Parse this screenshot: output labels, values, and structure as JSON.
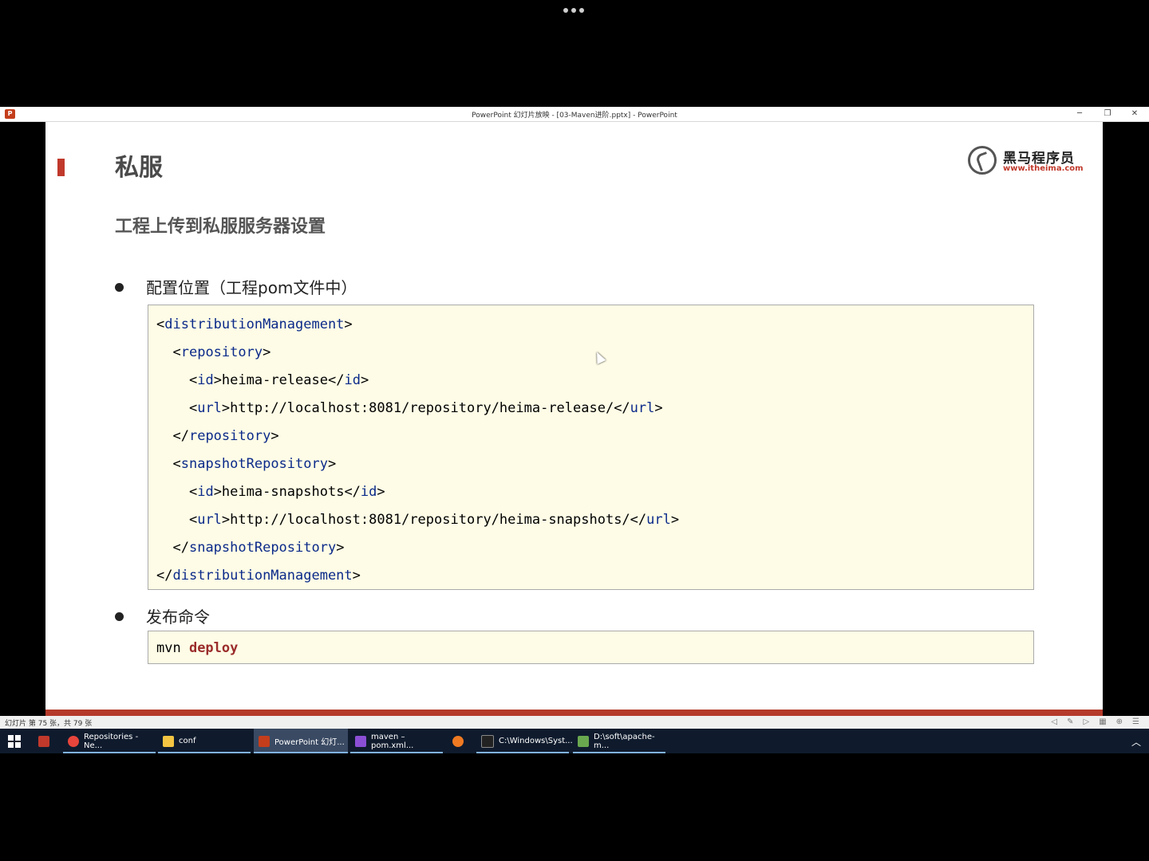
{
  "window": {
    "title": "PowerPoint 幻灯片放映 - [03-Maven进阶.pptx] - PowerPoint",
    "app_icon": "P"
  },
  "slide": {
    "title": "私服",
    "subtitle": "工程上传到私服服务器设置",
    "logo": {
      "cn": "黑马程序员",
      "url": "www.itheima.com"
    },
    "bullet1": "配置位置（工程pom文件中）",
    "bullet2": "发布命令",
    "code_lines": [
      {
        "indent": "",
        "open": "<",
        "tag": "distributionManagement",
        "close": ">"
      },
      {
        "indent": "  ",
        "open": "<",
        "tag": "repository",
        "close": ">"
      },
      {
        "indent": "    ",
        "open": "<",
        "tag": "id",
        "mid": ">heima-release</",
        "tag2": "id",
        "close": ">"
      },
      {
        "indent": "    ",
        "open": "<",
        "tag": "url",
        "mid": ">http://localhost:8081/repository/heima-release/</",
        "tag2": "url",
        "close": ">"
      },
      {
        "indent": "  ",
        "open": "</",
        "tag": "repository",
        "close": ">"
      },
      {
        "indent": "  ",
        "open": "<",
        "tag": "snapshotRepository",
        "close": ">"
      },
      {
        "indent": "    ",
        "open": "<",
        "tag": "id",
        "mid": ">heima-snapshots</",
        "tag2": "id",
        "close": ">"
      },
      {
        "indent": "    ",
        "open": "<",
        "tag": "url",
        "mid": ">http://localhost:8081/repository/heima-snapshots/</",
        "tag2": "url",
        "close": ">"
      },
      {
        "indent": "  ",
        "open": "</",
        "tag": "snapshotRepository",
        "close": ">"
      },
      {
        "indent": "",
        "open": "</",
        "tag": "distributionManagement",
        "close": ">"
      }
    ],
    "command": {
      "prefix": "mvn ",
      "keyword": "deploy"
    }
  },
  "status": {
    "slide_counter": "幻灯片 第 75 张，共 79 张"
  },
  "taskbar": {
    "items": [
      {
        "label": "Repositories - Ne...",
        "icon": "chrome-icon",
        "color": "#e8453c"
      },
      {
        "label": "conf",
        "icon": "folder-icon",
        "color": "#f4c542"
      },
      {
        "label": "PowerPoint 幻灯...",
        "icon": "powerpoint-icon",
        "color": "#c43e1c"
      },
      {
        "label": "maven – pom.xml...",
        "icon": "intellij-icon",
        "color": "#8b4fd6"
      },
      {
        "label": "",
        "icon": "sublime-icon",
        "color": "#f07a22"
      },
      {
        "label": "C:\\Windows\\Syst...",
        "icon": "cmd-icon",
        "color": "#222222"
      },
      {
        "label": "D:\\soft\\apache-m...",
        "icon": "notepad-icon",
        "color": "#6aa84f"
      }
    ]
  },
  "colors": {
    "accent": "#c0392b",
    "code_bg": "#fefce6",
    "tag": "#0b2a8a",
    "keyword": "#9b2c2c"
  }
}
